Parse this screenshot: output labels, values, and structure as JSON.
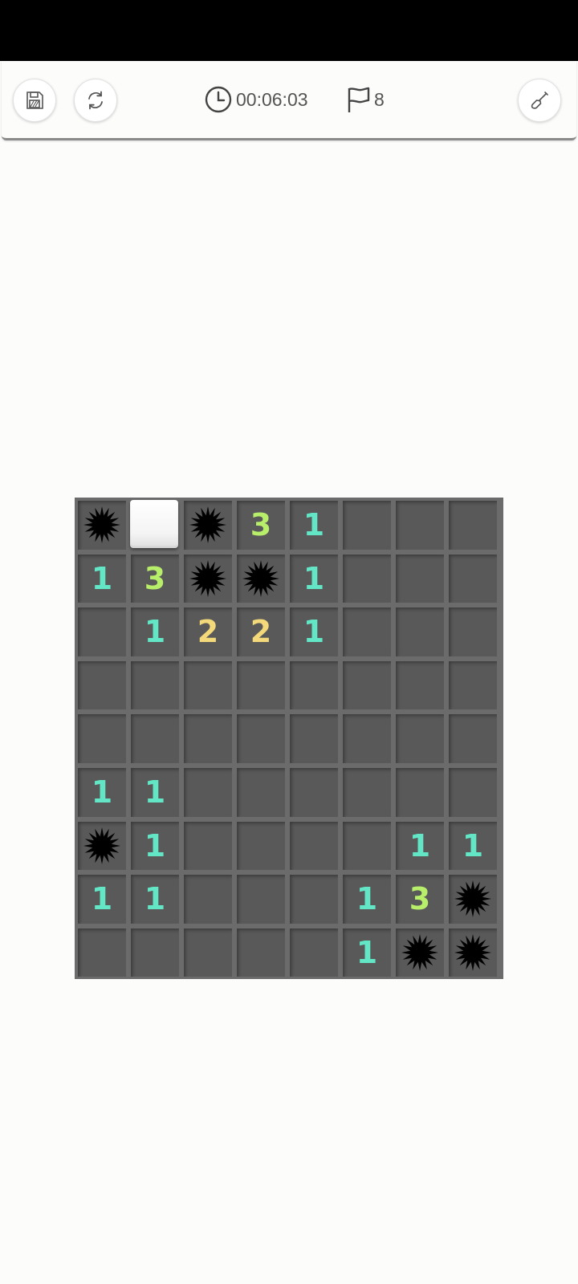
{
  "toolbar": {
    "timer": "00:06:03",
    "flag_count": "8",
    "save_icon": "save-icon",
    "restart_icon": "restart-icon",
    "dig_icon": "shovel-icon"
  },
  "colors": {
    "1": "#63e6c6",
    "2": "#f3d97a",
    "3": "#b8ef6a",
    "mine": "#000000",
    "revealed": "#595959",
    "hidden": "#ffffff"
  },
  "board": {
    "cols": 8,
    "rows": [
      [
        "M",
        "H",
        "M",
        "3",
        "1",
        "",
        "",
        ""
      ],
      [
        "1",
        "3",
        "M",
        "M",
        "1",
        "",
        "",
        ""
      ],
      [
        "",
        "1",
        "2",
        "2",
        "1",
        "",
        "",
        ""
      ],
      [
        "",
        "",
        "",
        "",
        "",
        "",
        "",
        ""
      ],
      [
        "",
        "",
        "",
        "",
        "",
        "",
        "",
        ""
      ],
      [
        "1",
        "1",
        "",
        "",
        "",
        "",
        "",
        ""
      ],
      [
        "M",
        "1",
        "",
        "",
        "",
        "",
        "1",
        "1"
      ],
      [
        "1",
        "1",
        "",
        "",
        "",
        "1",
        "3",
        "M"
      ],
      [
        "",
        "",
        "",
        "",
        "",
        "1",
        "M",
        "M"
      ]
    ]
  }
}
